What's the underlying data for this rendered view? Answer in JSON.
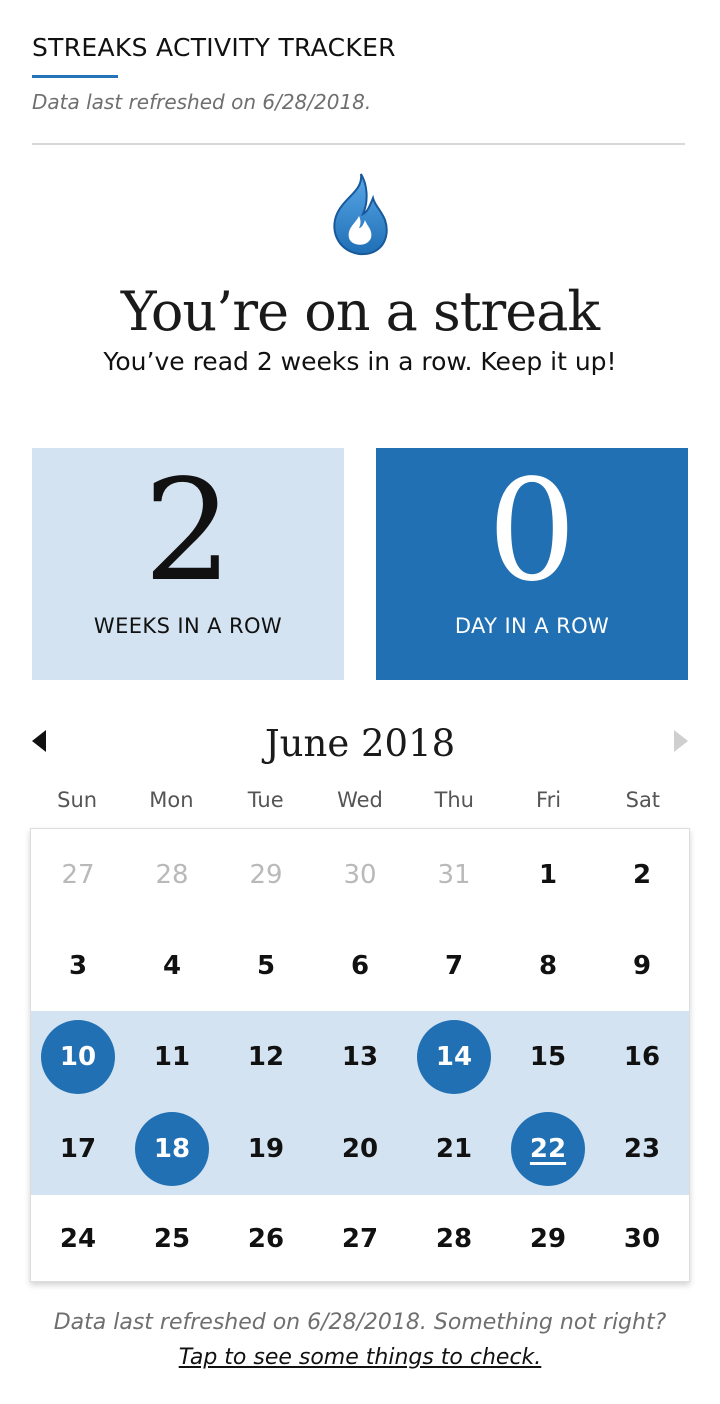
{
  "header": {
    "title": "STREAKS ACTIVITY TRACKER",
    "refreshed": "Data last refreshed on 6/28/2018."
  },
  "streak": {
    "icon": "flame-icon",
    "headline": "You’re on a streak",
    "subtitle": "You’ve read 2 weeks in a row. Keep it up!"
  },
  "stats": {
    "weeks": {
      "value": "2",
      "label": "WEEKS IN A ROW"
    },
    "days": {
      "value": "0",
      "label": "DAY IN A ROW"
    }
  },
  "calendar": {
    "month": "June 2018",
    "prev_icon": "triangle-left-icon",
    "next_icon": "triangle-right-icon",
    "weekdays": [
      "Sun",
      "Mon",
      "Tue",
      "Wed",
      "Thu",
      "Fri",
      "Sat"
    ],
    "weeks": [
      {
        "highlight": false,
        "days": [
          {
            "n": "27",
            "muted": true
          },
          {
            "n": "28",
            "muted": true
          },
          {
            "n": "29",
            "muted": true
          },
          {
            "n": "30",
            "muted": true
          },
          {
            "n": "31",
            "muted": true
          },
          {
            "n": "1"
          },
          {
            "n": "2"
          }
        ]
      },
      {
        "highlight": false,
        "days": [
          {
            "n": "3"
          },
          {
            "n": "4"
          },
          {
            "n": "5"
          },
          {
            "n": "6"
          },
          {
            "n": "7"
          },
          {
            "n": "8"
          },
          {
            "n": "9"
          }
        ]
      },
      {
        "highlight": true,
        "days": [
          {
            "n": "10",
            "read": true
          },
          {
            "n": "11"
          },
          {
            "n": "12"
          },
          {
            "n": "13"
          },
          {
            "n": "14",
            "read": true
          },
          {
            "n": "15"
          },
          {
            "n": "16"
          }
        ]
      },
      {
        "highlight": true,
        "days": [
          {
            "n": "17"
          },
          {
            "n": "18",
            "read": true
          },
          {
            "n": "19"
          },
          {
            "n": "20"
          },
          {
            "n": "21"
          },
          {
            "n": "22",
            "read": true,
            "today": true
          },
          {
            "n": "23"
          }
        ]
      },
      {
        "highlight": false,
        "days": [
          {
            "n": "24"
          },
          {
            "n": "25"
          },
          {
            "n": "26"
          },
          {
            "n": "27"
          },
          {
            "n": "28"
          },
          {
            "n": "29"
          },
          {
            "n": "30"
          }
        ]
      }
    ]
  },
  "footer": {
    "note": "Data last refreshed on 6/28/2018. Something not right?",
    "link": "Tap to see some things to check."
  },
  "colors": {
    "accent": "#2170b3",
    "light_accent": "#d3e3f2",
    "muted_text": "#6f6f6f"
  }
}
